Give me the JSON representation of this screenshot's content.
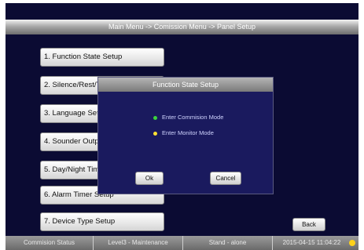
{
  "titlebar": {
    "breadcrumb": "Main Menu -> Comission Menu -> Panel Setup"
  },
  "menu": {
    "items": [
      {
        "label": "1. Function State Setup"
      },
      {
        "label": "2. Silence/Rest/Test Setup"
      },
      {
        "label": "3. Language Setup"
      },
      {
        "label": "4. Sounder Output Setup"
      },
      {
        "label": "5. Day/Night Time Setup"
      },
      {
        "label": "6. Alarm Timer Setup"
      },
      {
        "label": "7. Device Type Setup"
      }
    ]
  },
  "dialog": {
    "title": "Function State Setup",
    "options": [
      {
        "label": "Enter Commision Mode",
        "color": "#3cd33c"
      },
      {
        "label": "Enter Monitor Mode",
        "color": "#ffe033"
      }
    ],
    "ok_label": "Ok",
    "cancel_label": "Cancel"
  },
  "back_label": "Back",
  "status": {
    "mode": "Commision Status",
    "level": "Level3 - Maintenance",
    "network": "Stand - alone",
    "datetime": "2015-04-15 11:04:22",
    "indicator_color": "#ffd21a"
  }
}
